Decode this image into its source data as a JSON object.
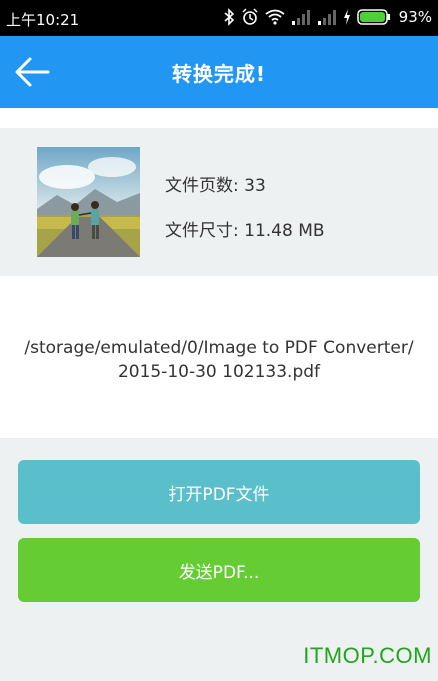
{
  "status_bar": {
    "time": "上午10:21",
    "battery": "93%"
  },
  "app_bar": {
    "title": "转换完成!"
  },
  "file_info": {
    "pages": "文件页数: 33",
    "size": "文件尺寸: 11.48 MB"
  },
  "path": {
    "line1": "/storage/emulated/0/Image to PDF Converter/",
    "line2": "2015-10-30 102133.pdf"
  },
  "buttons": {
    "open": "打开PDF文件",
    "send": "发送PDF..."
  },
  "watermark": "ITMOP.COM",
  "colors": {
    "app_bar": "#2196f3",
    "open_button": "#5bbfcb",
    "send_button": "#66cc33",
    "watermark": "#22a41c"
  }
}
